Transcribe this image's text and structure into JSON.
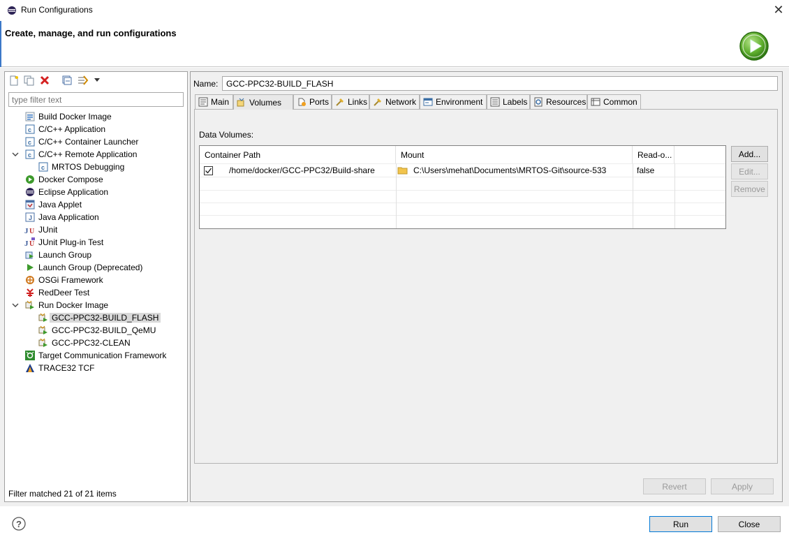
{
  "window": {
    "title": "Run Configurations",
    "close_glyph": "✕"
  },
  "banner": {
    "title": "Create, manage, and run configurations"
  },
  "left": {
    "filter_placeholder": "type filter text",
    "status": "Filter matched 21 of 21 items",
    "tree": [
      {
        "label": "Build Docker Image",
        "icon": "docker-build-icon"
      },
      {
        "label": "C/C++ Application",
        "icon": "c-app-icon"
      },
      {
        "label": "C/C++ Container Launcher",
        "icon": "c-app-icon"
      },
      {
        "label": "C/C++ Remote Application",
        "icon": "c-app-icon"
      },
      {
        "label": "MRTOS Debugging",
        "icon": "c-app-icon"
      },
      {
        "label": "Docker Compose",
        "icon": "docker-compose-icon"
      },
      {
        "label": "Eclipse Application",
        "icon": "eclipse-icon"
      },
      {
        "label": "Java Applet",
        "icon": "java-applet-icon"
      },
      {
        "label": "Java Application",
        "icon": "java-app-icon"
      },
      {
        "label": "JUnit",
        "icon": "junit-icon"
      },
      {
        "label": "JUnit Plug-in Test",
        "icon": "junit-plugin-icon"
      },
      {
        "label": "Launch Group",
        "icon": "launch-group-icon"
      },
      {
        "label": "Launch Group (Deprecated)",
        "icon": "launch-group-deprecated-icon"
      },
      {
        "label": "OSGi Framework",
        "icon": "osgi-icon"
      },
      {
        "label": "RedDeer Test",
        "icon": "reddeer-icon"
      },
      {
        "label": "Run Docker Image",
        "icon": "docker-run-icon"
      },
      {
        "label": "GCC-PPC32-BUILD_FLASH",
        "icon": "docker-run-icon"
      },
      {
        "label": "GCC-PPC32-BUILD_QeMU",
        "icon": "docker-run-icon"
      },
      {
        "label": "GCC-PPC32-CLEAN",
        "icon": "docker-run-icon"
      },
      {
        "label": "Target Communication Framework",
        "icon": "tcf-icon"
      },
      {
        "label": "TRACE32 TCF",
        "icon": "trace32-icon"
      }
    ]
  },
  "right": {
    "name_label": "Name:",
    "name_value": "GCC-PPC32-BUILD_FLASH",
    "tabs": [
      "Main",
      "Volumes",
      "Ports",
      "Links",
      "Network",
      "Environment",
      "Labels",
      "Resources",
      "Common"
    ],
    "active_tab": "Volumes",
    "section_label": "Data Volumes:",
    "table": {
      "headers": [
        "Container Path",
        "Mount",
        "Read-o..."
      ],
      "rows": [
        {
          "checked": true,
          "container_path": "/home/docker/GCC-PPC32/Build-share",
          "mount": "C:\\Users\\mehat\\Documents\\MRTOS-Git\\source-533",
          "read_only": "false"
        }
      ]
    },
    "side_buttons": {
      "add": "Add...",
      "edit": "Edit...",
      "remove": "Remove"
    },
    "revert": "Revert",
    "apply": "Apply"
  },
  "footer": {
    "run": "Run",
    "close": "Close",
    "help_glyph": "?"
  }
}
